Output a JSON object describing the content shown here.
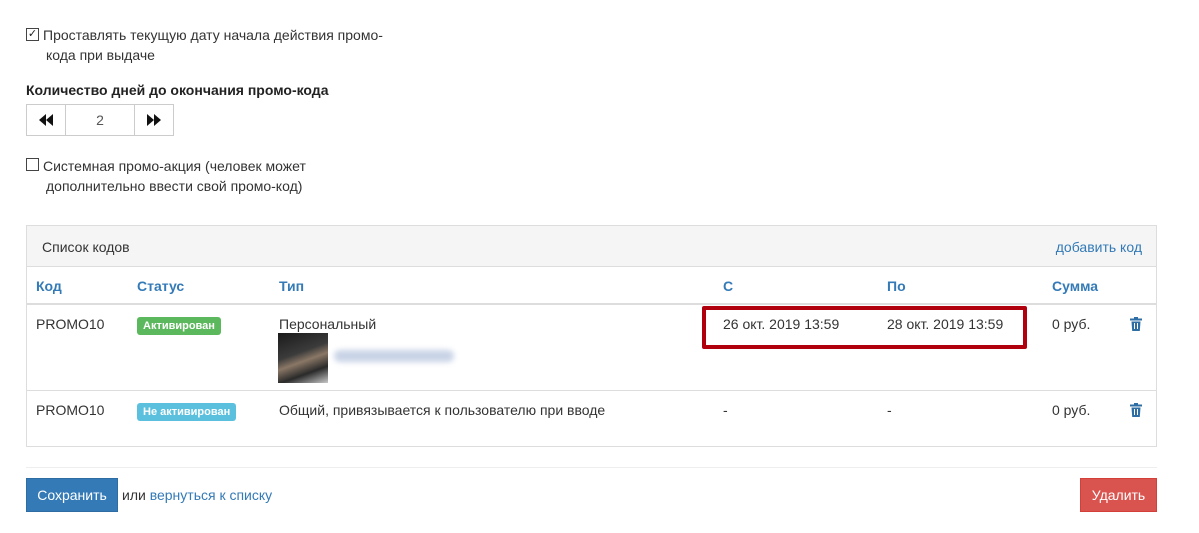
{
  "settings": {
    "auto_date_checked": true,
    "auto_date_line1": "Проставлять текущую дату начала действия промо-",
    "auto_date_line2": "кода при выдаче",
    "days_label": "Количество дней до окончания промо-кода",
    "days_value": "2",
    "days_decrease_icon": "double-left-arrow-icon",
    "days_increase_icon": "double-right-arrow-icon",
    "system_promo_checked": false,
    "system_promo_line1": "Системная промо-акция (человек может",
    "system_promo_line2": "дополнительно ввести свой промо-код)"
  },
  "codes_panel": {
    "title": "Список кодов",
    "add_link": "добавить код",
    "columns": [
      "Код",
      "Статус",
      "Тип",
      "С",
      "По",
      "Сумма"
    ],
    "rows": [
      {
        "code": "PROMO10",
        "status": "Активирован",
        "status_color": "#5cb85c",
        "type": "Персональный",
        "from": "26 окт. 2019 13:59",
        "to": "28 окт. 2019 13:59",
        "sum": "0 руб.",
        "icon": "trash-icon"
      },
      {
        "code": "PROMO10",
        "status": "Не активирован",
        "status_color": "#5bc0de",
        "type": "Общий, привязывается к пользователю при вводе",
        "from": "-",
        "to": "-",
        "sum": "0 руб.",
        "icon": "trash-icon"
      }
    ]
  },
  "footer": {
    "save_label": "Сохранить",
    "or_text": "или",
    "back_link": "вернуться к списку",
    "delete_label": "Удалить"
  },
  "colors": {
    "primary": "#337ab7",
    "danger": "#d9534f",
    "highlight": "#b0000e"
  }
}
